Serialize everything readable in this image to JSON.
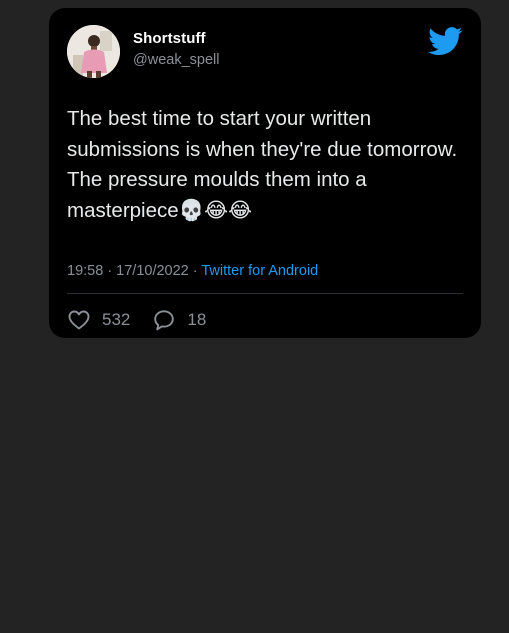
{
  "tweet": {
    "author": {
      "display_name": "Shortstuff",
      "handle": "@weak_spell"
    },
    "text": "The best time to start your written submissions is when they're due tomorrow. The pressure moulds them into a masterpiece💀😂😂",
    "timestamp": "19:58 · 17/10/2022",
    "separator": " · ",
    "source": "Twitter for Android",
    "likes": "532",
    "replies": "18"
  },
  "icons": {
    "brand": "twitter-bird-icon",
    "like": "heart-icon",
    "reply": "speech-bubble-icon"
  },
  "colors": {
    "background": "#232323",
    "card": "#000000",
    "text": "#e7e9ea",
    "muted": "#8b9096",
    "accent": "#1d9bf0"
  }
}
